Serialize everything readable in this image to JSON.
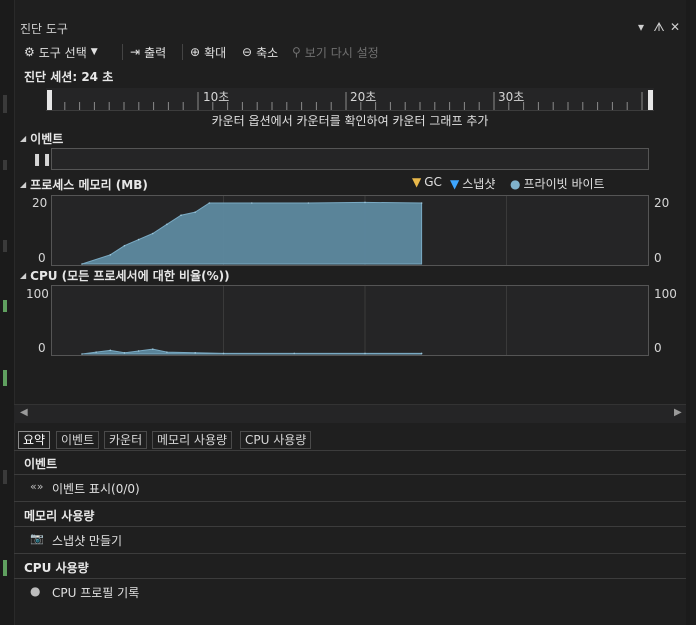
{
  "window": {
    "title": "진단 도구",
    "controls": [
      "▾",
      "ᗑ",
      "✕"
    ]
  },
  "toolbar": {
    "select_tools": "도구 선택",
    "output": "출력",
    "zoom_in": "확대",
    "zoom_out": "축소",
    "reset_view": "보기 다시 설정"
  },
  "session": {
    "label": "진단 세션: 24 초"
  },
  "timeline": {
    "labels": [
      "10초",
      "20초",
      "30초"
    ]
  },
  "hint": "카운터 옵션에서 카운터를 확인하여 카운터 그래프 추가",
  "events_section": {
    "title": "이벤트"
  },
  "memory_section": {
    "title": "프로세스 메모리 (MB)",
    "legend": {
      "gc": "GC",
      "snapshot": "스냅샷",
      "private_bytes": "프라이빗 바이트"
    },
    "y_top": "20",
    "y_bottom": "0"
  },
  "cpu_section": {
    "title": "CPU (모든 프로세서에 대한 비율(%))",
    "y_top": "100",
    "y_bottom": "0"
  },
  "chart_data": [
    {
      "type": "area",
      "title": "프로세스 메모리 (MB)",
      "series": [
        {
          "name": "프라이빗 바이트",
          "x": [
            0,
            2,
            3,
            4,
            5,
            6,
            7,
            8,
            9,
            12,
            16,
            20,
            24
          ],
          "values": [
            0,
            3,
            6,
            8,
            10,
            13,
            16,
            17,
            20,
            20,
            20,
            20.2,
            20
          ]
        }
      ],
      "xlabel": "",
      "ylabel": "",
      "ylim": [
        0,
        20
      ],
      "xlim": [
        0,
        40
      ],
      "color": "#5d8aa0"
    },
    {
      "type": "area",
      "title": "CPU (모든 프로세서에 대한 비율(%))",
      "series": [
        {
          "name": "",
          "x": [
            0,
            1,
            2,
            3,
            4,
            5,
            6,
            8,
            10,
            15,
            20,
            24
          ],
          "values": [
            0,
            3,
            6,
            2,
            5,
            8,
            3,
            2,
            1,
            1,
            1,
            1
          ]
        }
      ],
      "xlabel": "",
      "ylabel": "",
      "ylim": [
        0,
        100
      ],
      "xlim": [
        0,
        40
      ],
      "color": "#5d8aa0"
    }
  ],
  "tabs": [
    "요약",
    "이벤트",
    "카운터",
    "메모리 사용량",
    "CPU 사용량"
  ],
  "summary": {
    "events_group": "이벤트",
    "events_row": "이벤트 표시(0/0)",
    "memory_group": "메모리 사용량",
    "memory_row": "스냅샷 만들기",
    "cpu_group": "CPU 사용량",
    "cpu_row": "CPU 프로필 기록"
  }
}
